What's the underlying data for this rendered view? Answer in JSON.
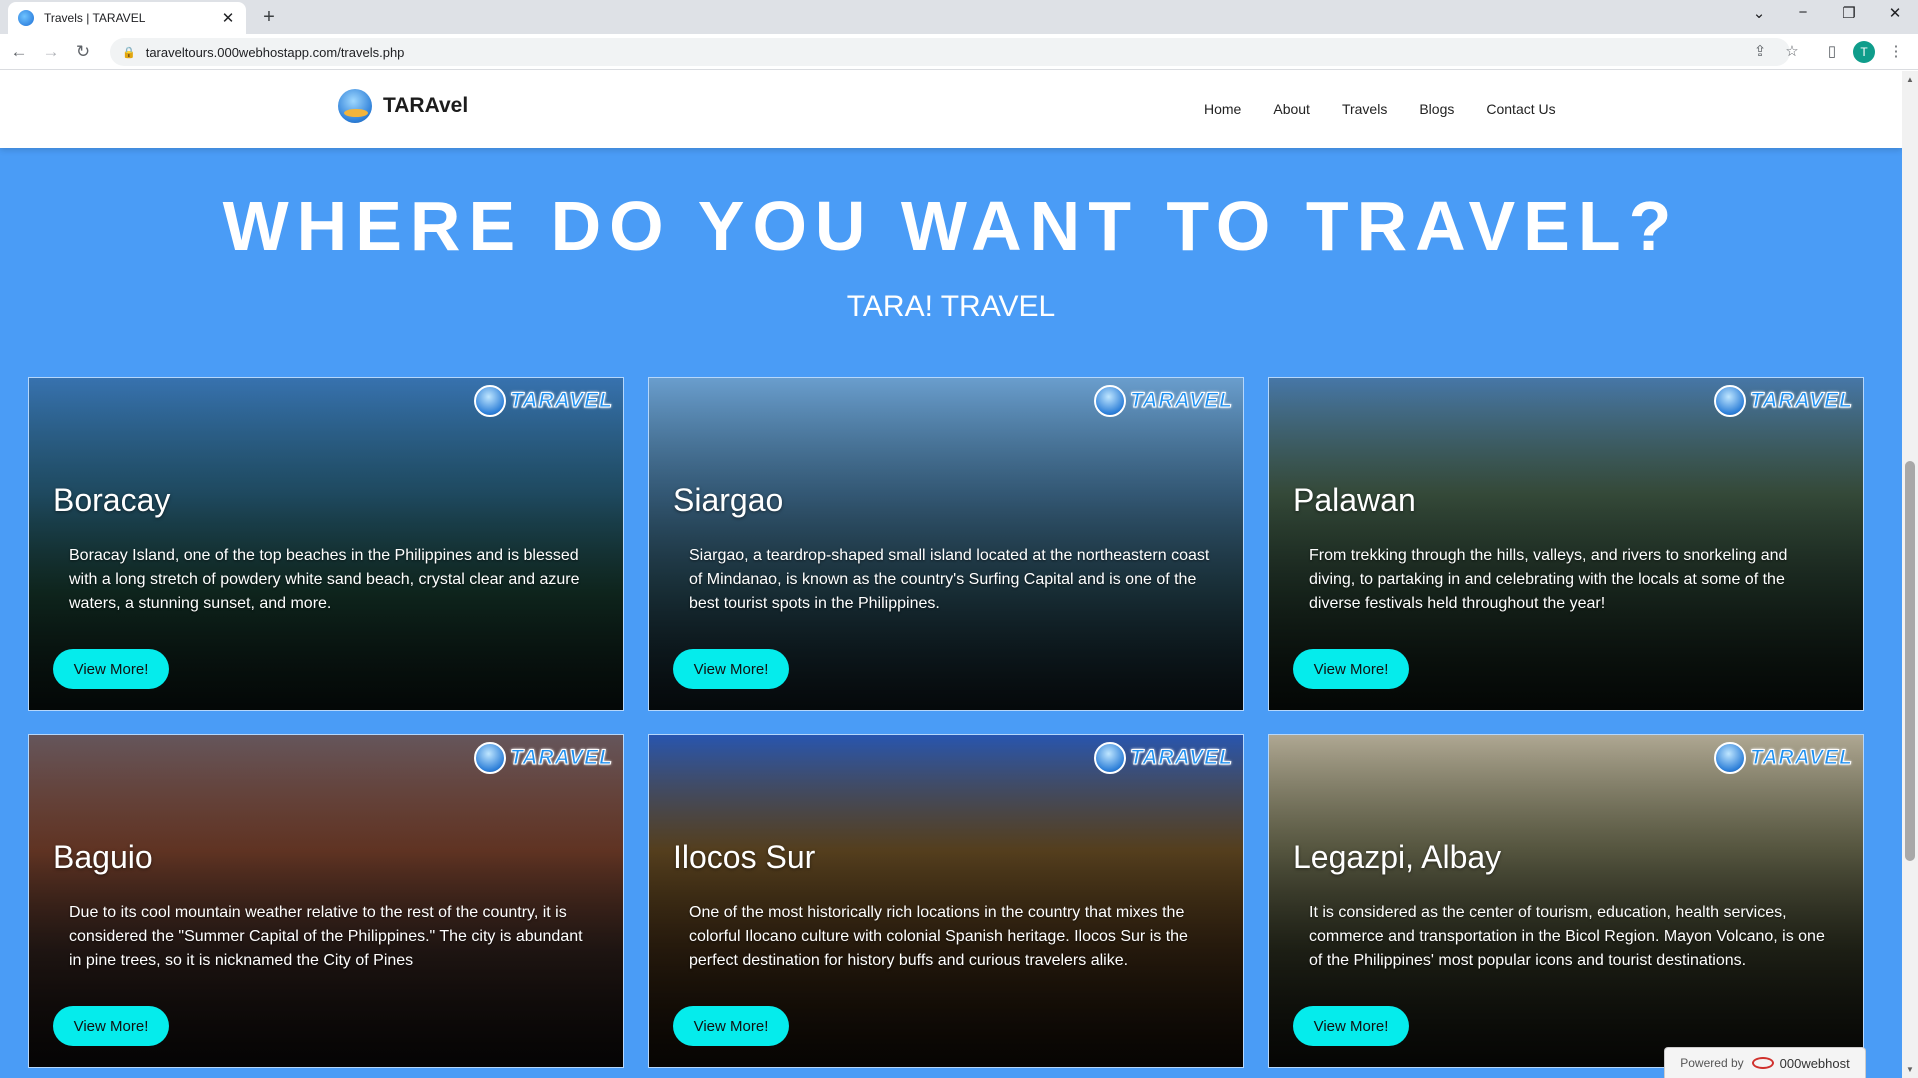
{
  "browser": {
    "tab_title": "Travels | TARAVEL",
    "tab_close": "✕",
    "new_tab": "+",
    "url": "taraveltours.000webhostapp.com/travels.php",
    "profile_initial": "T"
  },
  "site": {
    "brand": "TARAvel",
    "nav": [
      "Home",
      "About",
      "Travels",
      "Blogs",
      "Contact Us"
    ]
  },
  "hero": {
    "title": "WHERE DO YOU WANT TO TRAVEL?",
    "subtitle": "TARA! TRAVEL"
  },
  "badge_text": "TARAVEL",
  "cards": [
    {
      "name": "Boracay",
      "description": "Boracay Island, one of the top beaches in the Philippines and is blessed with a long stretch of powdery white sand beach, crystal clear and azure waters, a stunning sunset, and more.",
      "button": "View More!",
      "bg": [
        "#3a78b8",
        "#2c6a8a",
        "#1d4a3a",
        "#0f1e1a"
      ]
    },
    {
      "name": "Siargao",
      "description": "Siargao, a teardrop-shaped small island located at the northeastern coast of Mindanao, is known as the country's Surfing Capital and is one of the best tourist spots in the Philippines.",
      "button": "View More!",
      "bg": [
        "#6fa6d8",
        "#4a7fa8",
        "#2f5a6a",
        "#13222a"
      ]
    },
    {
      "name": "Palawan",
      "description": "From trekking through the hills, valleys, and rivers to snorkeling and diving, to partaking in and celebrating with the locals at some of the diverse festivals held throughout the year!",
      "button": "View More!",
      "bg": [
        "#4a7db0",
        "#4c6a52",
        "#2c4636",
        "#0f1a14"
      ]
    },
    {
      "name": "Baguio",
      "description": "Due to its cool mountain weather relative to the rest of the country, it is considered the \"Summer Capital of the Philippines.\" The city is abundant in pine trees, so it is nicknamed the City of Pines",
      "button": "View More!",
      "bg": [
        "#6a5a60",
        "#8a4a32",
        "#3d2a24",
        "#141010"
      ]
    },
    {
      "name": "Ilocos Sur",
      "description": "One of the most historically rich locations in the country that mixes the colorful Ilocano culture with colonial Spanish heritage. Ilocos Sur is the perfect destination for history buffs and curious travelers alike.",
      "button": "View More!",
      "bg": [
        "#2a5ab8",
        "#7a5a2a",
        "#4a3218",
        "#1a120a"
      ]
    },
    {
      "name": "Legazpi, Albay",
      "description": "It is considered as the center of tourism, education, health services, commerce and transportation in the Bicol Region. Mayon Volcano, is one of the Philippines' most popular icons and tourist destinations.",
      "button": "View More!",
      "bg": [
        "#b8b09a",
        "#7a7a5a",
        "#3a3e2a",
        "#141610"
      ]
    }
  ],
  "powered": {
    "prefix": "Powered by",
    "name": "000webhost"
  },
  "colors": {
    "page_bg": "#4a9cf6",
    "button": "#05ecec"
  }
}
